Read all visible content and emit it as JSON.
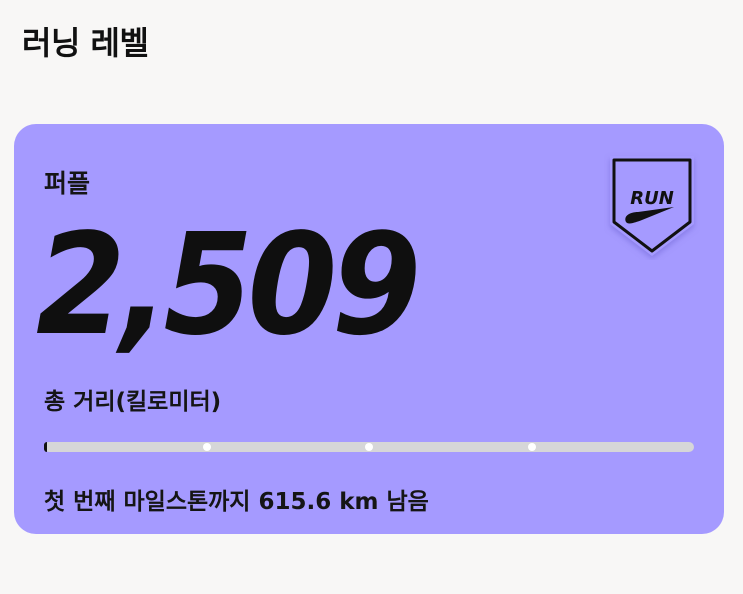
{
  "page": {
    "title": "러닝 레벨"
  },
  "level_card": {
    "background_color": "#a59aff",
    "level_name": "퍼플",
    "total_distance": "2,509",
    "distance_label": "총 거리(킬로미터)",
    "progress_fraction": 0.005,
    "milestone_count": 3,
    "progress_text": "첫 번째 마일스톤까지 615.6 km 남음",
    "badge": {
      "label": "RUN",
      "icon": "nike-run-badge-icon"
    }
  }
}
